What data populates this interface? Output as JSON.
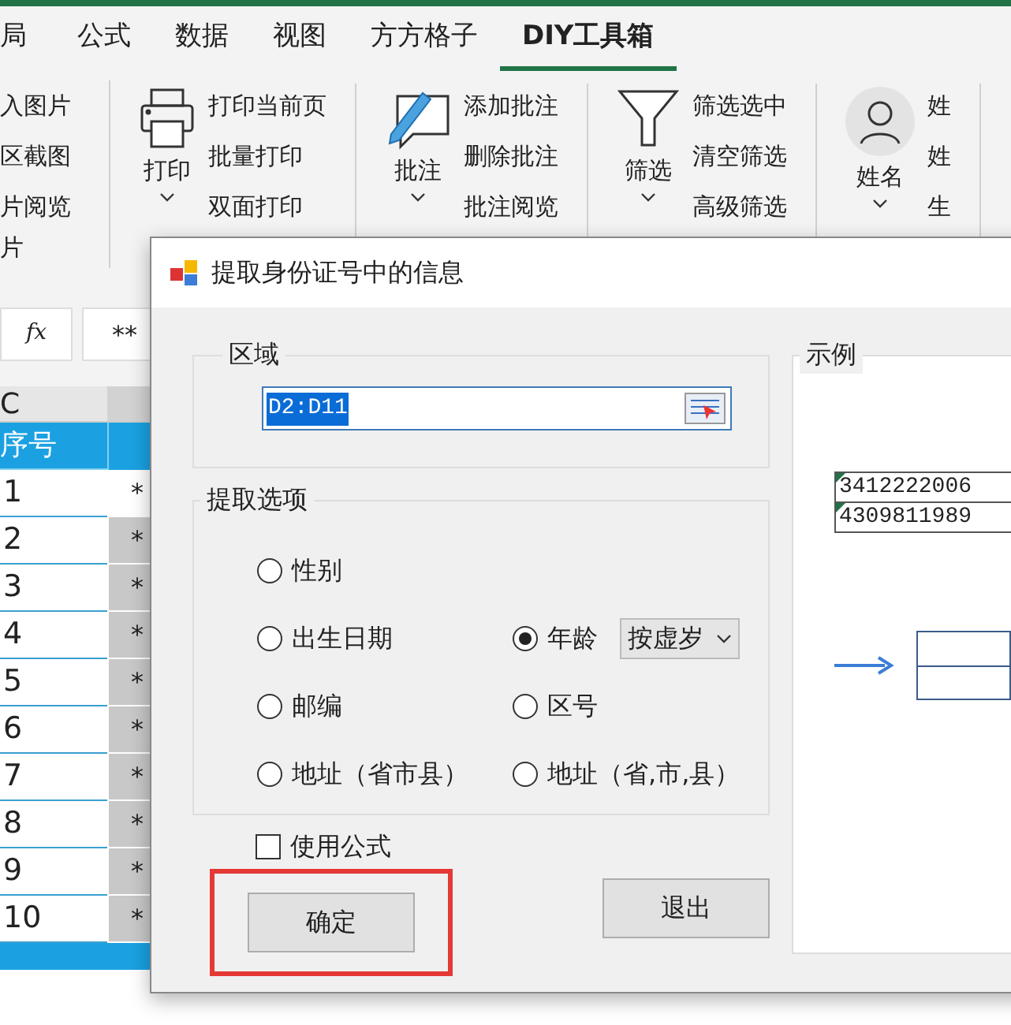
{
  "ribbon_tabs": [
    {
      "label": "局",
      "selected": false
    },
    {
      "label": "公式",
      "selected": false
    },
    {
      "label": "数据",
      "selected": false
    },
    {
      "label": "视图",
      "selected": false
    },
    {
      "label": "方方格子",
      "selected": false
    },
    {
      "label": "DIY工具箱",
      "selected": true
    }
  ],
  "ribbon_groups": [
    {
      "kind": "list",
      "items": [
        "入图片",
        "区截图",
        "片阅览"
      ],
      "footer": "片"
    },
    {
      "kind": "big",
      "label": "打印",
      "items": [
        "打印当前页",
        "批量打印",
        "双面打印"
      ]
    },
    {
      "kind": "big",
      "label": "批注",
      "items": [
        "添加批注",
        "删除批注",
        "批注阅览"
      ]
    },
    {
      "kind": "big",
      "label": "筛选",
      "items": [
        "筛选选中",
        "清空筛选",
        "高级筛选"
      ]
    },
    {
      "kind": "big",
      "label": "姓名",
      "items": [
        "姓",
        "姓",
        "生"
      ]
    }
  ],
  "formula_bar": {
    "function_label": "fx",
    "value": "**"
  },
  "sheet": {
    "column_header": "C",
    "header_cell": "序号",
    "rows": [
      {
        "c": "1",
        "d": "*"
      },
      {
        "c": "2",
        "d": "*"
      },
      {
        "c": "3",
        "d": "*"
      },
      {
        "c": "4",
        "d": "*"
      },
      {
        "c": "5",
        "d": "*"
      },
      {
        "c": "6",
        "d": "*"
      },
      {
        "c": "7",
        "d": "*"
      },
      {
        "c": "8",
        "d": "*"
      },
      {
        "c": "9",
        "d": "*"
      },
      {
        "c": "10",
        "d": "*"
      }
    ]
  },
  "dialog": {
    "title": "提取身份证号中的信息",
    "range_group": {
      "label": "区域",
      "value": "D2:D11"
    },
    "options_group": {
      "label": "提取选项",
      "rows": [
        [
          {
            "label": "性别",
            "selected": false
          }
        ],
        [
          {
            "label": "出生日期",
            "selected": false
          },
          {
            "label": "年龄",
            "selected": true,
            "dropdown": "按虚岁"
          }
        ],
        [
          {
            "label": "邮编",
            "selected": false
          },
          {
            "label": "区号",
            "selected": false
          }
        ],
        [
          {
            "label": "地址（省市县）",
            "selected": false
          },
          {
            "label": "地址（省,市,县）",
            "selected": false
          }
        ]
      ]
    },
    "use_formula": {
      "label": "使用公式",
      "checked": false
    },
    "buttons": [
      {
        "label": "确定",
        "highlighted": true
      },
      {
        "label": "退出",
        "highlighted": false
      }
    ],
    "example_group": {
      "label": "示例",
      "cells": [
        "3412222006",
        "4309811989"
      ]
    }
  }
}
